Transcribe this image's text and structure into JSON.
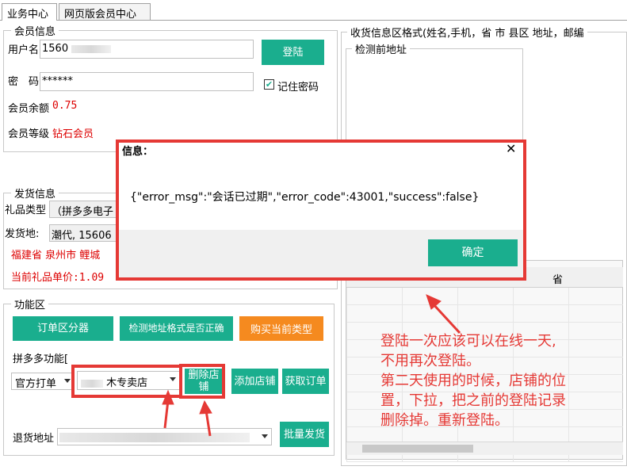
{
  "tabs": [
    "业务中心",
    "网页版会员中心"
  ],
  "member": {
    "legend": "会员信息",
    "user_label": "用户名",
    "user_value": "1560",
    "pass_label": "密　码",
    "pass_value": "******",
    "login_label": "登陆",
    "remember_label": "记住密码",
    "balance_label": "会员余额",
    "balance_value": "0.75",
    "level_label": "会员等级",
    "level_value": "钻石会员"
  },
  "ship": {
    "legend": "发货信息",
    "gift_label": "礼品类型",
    "gift_value": "（拼多多电子",
    "from_label": "发货地:",
    "from_value": "潮代, 15606",
    "region": "福建省  泉州市  鲤城",
    "price": "当前礼品单价:1.09"
  },
  "func": {
    "legend": "功能区",
    "btn_orders": "订单区分器",
    "btn_check": "检测地址格式是否正确",
    "btn_buy": "购买当前类型",
    "pdd_label": "拼多多功能[",
    "mode_value": "官方打单",
    "shop_value": "木专卖店",
    "btn_delete_shop": "删除店铺",
    "btn_add_shop": "添加店铺",
    "btn_get_orders": "获取订单",
    "return_label": "退货地址",
    "btn_batch": "批量发货"
  },
  "right": {
    "legend": "收货信息区格式(姓名,手机，省 市 县区 地址，邮编",
    "pre_legend": "检测前地址",
    "col_province": "省"
  },
  "dialog": {
    "title": "信息：",
    "close": "✕",
    "message": "{\"error_msg\":\"会话已过期\",\"error_code\":43001,\"success\":false}",
    "ok_label": "确定"
  },
  "annotation": {
    "lines": [
      "登陆一次应该可以在线一天,",
      "不用再次登陆。",
      "第二天使用的时候，店铺的位",
      "置，下拉，把之前的登陆记录",
      "删除掉。重新登陆。"
    ]
  }
}
